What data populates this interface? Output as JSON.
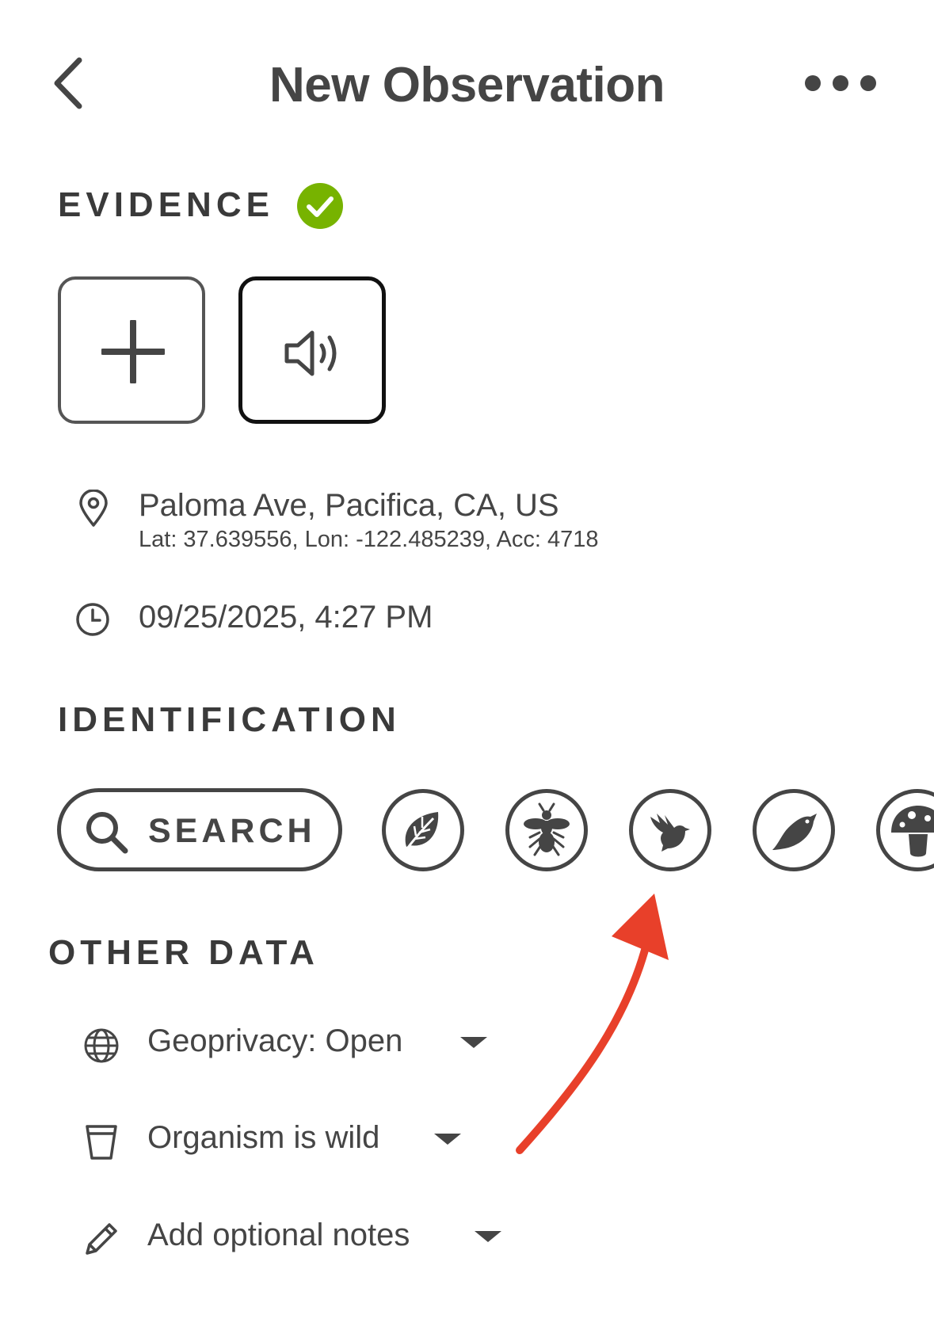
{
  "header": {
    "title": "New Observation",
    "back_icon": "chevron-left-icon",
    "more_icon": "ellipsis-icon"
  },
  "evidence": {
    "title": "EVIDENCE",
    "status_icon": "check-circle-icon",
    "status_color": "#77b300",
    "add_icon": "plus-icon",
    "sound_icon": "speaker-icon"
  },
  "location": {
    "icon": "map-pin-icon",
    "place": "Paloma Ave, Pacifica, CA, US",
    "coords": "Lat: 37.639556, Lon: -122.485239, Acc: 4718"
  },
  "datetime": {
    "icon": "clock-icon",
    "value": "09/25/2025, 4:27 PM"
  },
  "identification": {
    "title": "IDENTIFICATION",
    "search_label": "SEARCH",
    "search_icon": "search-icon",
    "iconic_taxa": [
      "plants-icon",
      "insects-icon",
      "birds-icon",
      "amphibians-icon",
      "fungi-icon"
    ]
  },
  "other_data": {
    "title": "OTHER DATA",
    "geoprivacy": "Geoprivacy: Open",
    "captive": "Organism is wild",
    "notes": "Add optional notes"
  },
  "annotation": {
    "arrow_color": "#e8402a"
  }
}
